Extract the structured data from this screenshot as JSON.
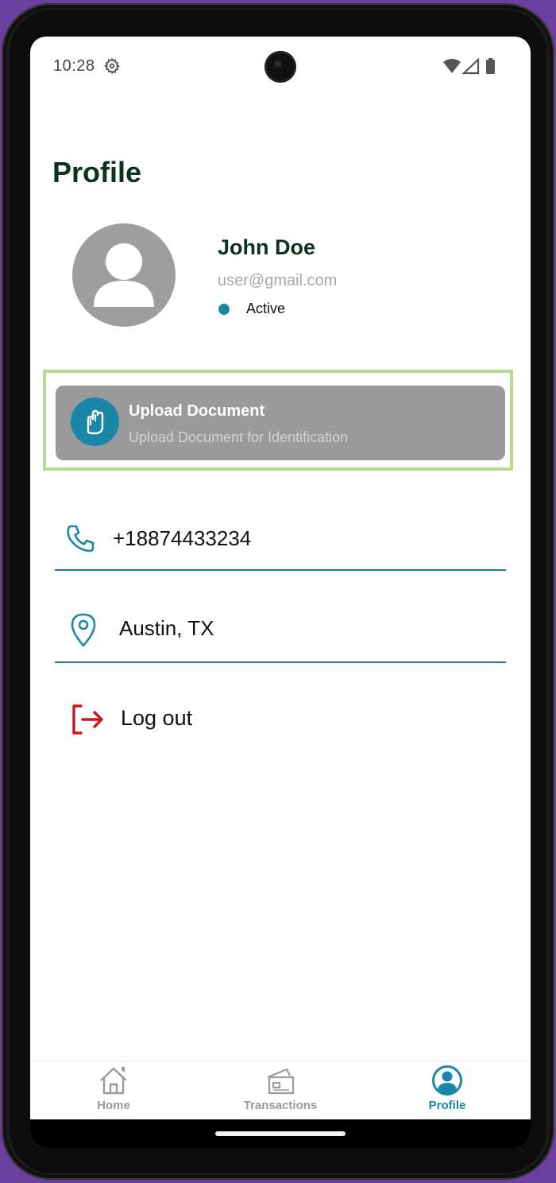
{
  "status_bar": {
    "time": "10:28",
    "icons": [
      "settings-icon",
      "wifi-icon",
      "signal-icon",
      "battery-icon"
    ]
  },
  "page": {
    "title": "Profile"
  },
  "profile": {
    "name": "John Doe",
    "email": "user@gmail.com",
    "status": "Active",
    "status_color": "#1a86a8"
  },
  "upload_card": {
    "title": "Upload Document",
    "subtitle": "Upload Document for Identification",
    "icon": "attachment-hand-icon"
  },
  "contact": {
    "phone": "+18874433234",
    "location": "Austin, TX"
  },
  "logout": {
    "label": "Log out",
    "color": "#d0141b"
  },
  "bottom_nav": {
    "items": [
      {
        "label": "Home",
        "icon": "home-icon",
        "active": false
      },
      {
        "label": "Transactions",
        "icon": "card-icon",
        "active": false
      },
      {
        "label": "Profile",
        "icon": "user-circle-icon",
        "active": true
      }
    ]
  },
  "colors": {
    "accent": "#1a86a8",
    "title": "#0b3320",
    "highlight": "#b7dc8f"
  }
}
